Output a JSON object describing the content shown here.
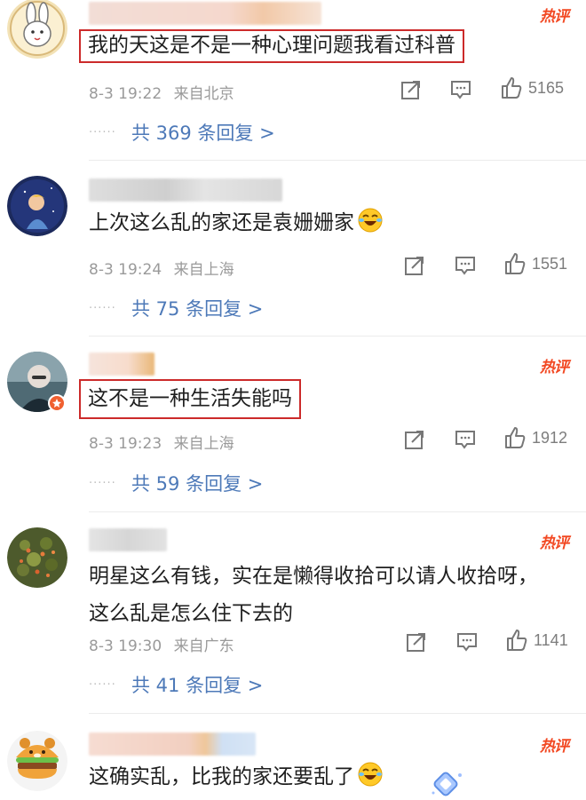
{
  "hot_label": "热评",
  "comments": [
    {
      "text": "我的天这是不是一种心理问题我看过科普",
      "date": "8-3 19:22",
      "location": "来自北京",
      "likes": "5165",
      "replies": "共 369 条回复 >",
      "highlighted": true,
      "hot": true
    },
    {
      "text": "上次这么乱的家还是袁姗姗家",
      "date": "8-3 19:24",
      "location": "来自上海",
      "likes": "1551",
      "replies": "共 75 条回复 >",
      "highlighted": false,
      "hot": false
    },
    {
      "text": "这不是一种生活失能吗",
      "date": "8-3 19:23",
      "location": "来自上海",
      "likes": "1912",
      "replies": "共 59 条回复 >",
      "highlighted": true,
      "hot": true
    },
    {
      "text": "明星这么有钱，实在是懒得收拾可以请人收拾呀，这么乱是怎么住下去的",
      "date": "8-3 19:30",
      "location": "来自广东",
      "likes": "1141",
      "replies": "共 41 条回复 >",
      "highlighted": false,
      "hot": true
    },
    {
      "text": "这确实乱，比我的家还要乱了",
      "highlighted": false,
      "hot": true
    }
  ],
  "colors": {
    "hot": "#f24822",
    "highlight_box": "#cc2a2a",
    "reply_link": "#4d79b8",
    "meta": "#9a9a9a"
  },
  "icons": [
    "share-icon",
    "comment-icon",
    "like-icon",
    "laughing-emoji-icon",
    "verified-badge-icon"
  ]
}
